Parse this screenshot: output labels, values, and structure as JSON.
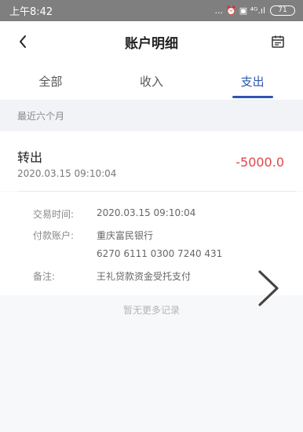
{
  "status_bar": {
    "time": "上午8:42",
    "icons_text": "... ⏰ ▣ ⁴ᴳ.ıl",
    "battery": "71"
  },
  "nav": {
    "title": "账户明细",
    "back_icon": "chevron-left-icon",
    "calendar_icon": "calendar-icon"
  },
  "tabs": [
    {
      "label": "全部",
      "active": false
    },
    {
      "label": "收入",
      "active": false
    },
    {
      "label": "支出",
      "active": true
    }
  ],
  "section": {
    "label": "最近六个月"
  },
  "record": {
    "title": "转出",
    "time": "2020.03.15  09:10:04",
    "amount": "-5000.0",
    "amount_color": "#e0474a"
  },
  "detail": {
    "rows": [
      {
        "label": "交易时间:",
        "value": "2020.03.15  09:10:04"
      },
      {
        "label": "付款账户:",
        "value": "重庆富民银行"
      },
      {
        "label": "",
        "value": "6270 6111 0300 7240 431"
      },
      {
        "label": "备注:",
        "value": "王礼贷款资金受托支付"
      }
    ]
  },
  "footer": {
    "no_more": "暂无更多记录"
  },
  "colors": {
    "accent": "#2f55b3",
    "status_bar": "#7f7f7f"
  }
}
